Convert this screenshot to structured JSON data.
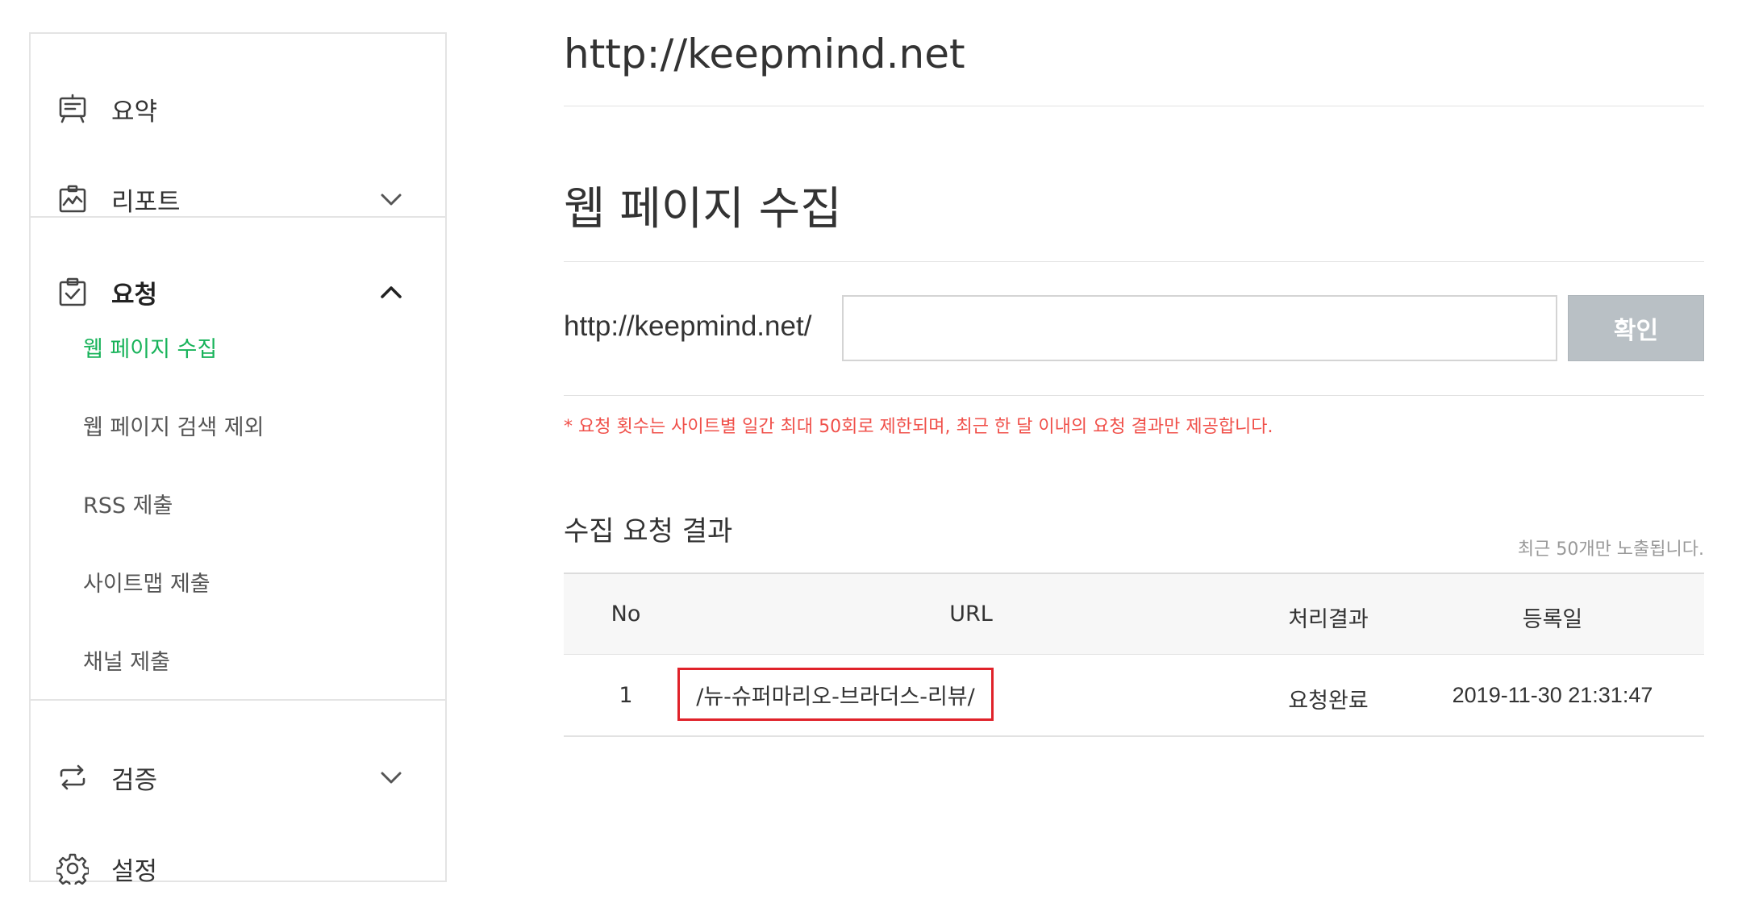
{
  "sidebar": {
    "summary": {
      "label": "요약",
      "icon": "presentation-board-icon"
    },
    "report": {
      "label": "리포트",
      "icon": "chart-board-icon",
      "chevron": "chevron-down-icon"
    },
    "request": {
      "label": "요청",
      "icon": "clipboard-check-icon",
      "chevron": "chevron-up-icon",
      "items": [
        {
          "label": "웹 페이지 수집",
          "active": true
        },
        {
          "label": "웹 페이지 검색 제외"
        },
        {
          "label": "RSS 제출"
        },
        {
          "label": "사이트맵 제출"
        },
        {
          "label": "채널 제출"
        }
      ]
    },
    "verify": {
      "label": "검증",
      "icon": "repeat-arrows-icon",
      "chevron": "chevron-down-icon"
    },
    "settings": {
      "label": "설정",
      "icon": "gear-icon"
    }
  },
  "main": {
    "site_url": "http://keepmind.net",
    "page_title": "웹 페이지 수집",
    "url_prefix": "http://keepmind.net/",
    "input_value": "",
    "confirm_label": "확인",
    "notice": "* 요청 횟수는 사이트별 일간 최대 50회로 제한되며, 최근 한 달 이내의 요청 결과만 제공합니다.",
    "results_title": "수집 요청 결과",
    "results_note": "최근 50개만 노출됩니다.",
    "table": {
      "headers": [
        "No",
        "URL",
        "처리결과",
        "등록일"
      ],
      "rows": [
        {
          "no": "1",
          "url": "/뉴-슈퍼마리오-브라더스-리뷰/",
          "status": "요청완료",
          "date": "2019-11-30 21:31:47"
        }
      ]
    }
  },
  "colors": {
    "active_green": "#18b35a",
    "notice_red": "#f0504a",
    "highlight_red": "#e0222a",
    "button_gray": "#b9c0c5"
  }
}
